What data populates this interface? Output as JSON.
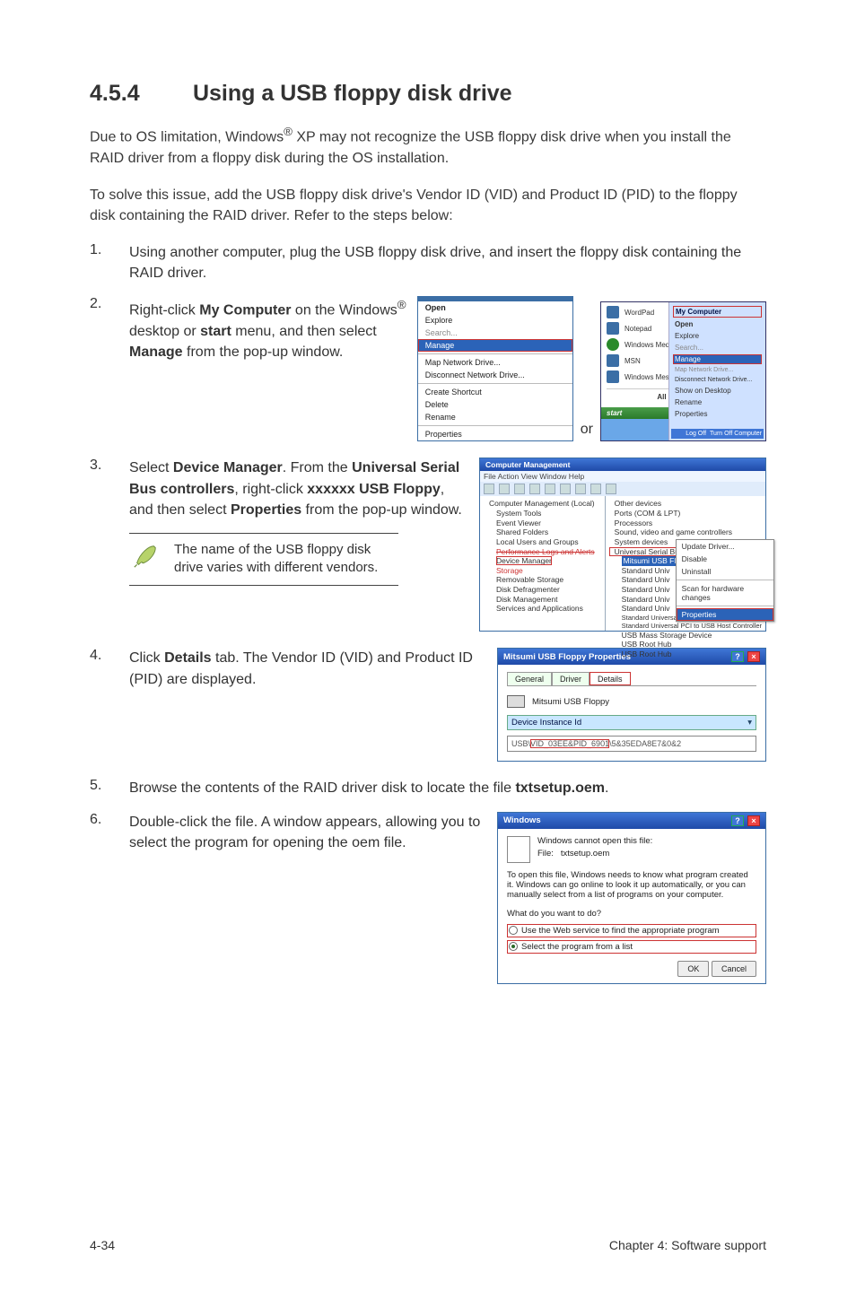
{
  "heading": {
    "num": "4.5.4",
    "title": "Using a USB floppy disk drive"
  },
  "p1a": "Due to OS limitation, Windows",
  "p1_reg": "®",
  "p1b": " XP may not recognize the USB floppy disk drive when you install the RAID driver from a floppy disk during the OS installation.",
  "p2": "To solve this issue, add the USB floppy disk drive's Vendor ID (VID) and Product ID (PID) to the floppy disk containing the RAID driver. Refer to the steps below:",
  "step1": "Using another computer, plug the USB floppy disk drive, and insert the floppy disk containing the RAID driver.",
  "step2": {
    "a": "Right-click ",
    "b_my_computer": "My Computer",
    "c": " on the Windows",
    "reg": "®",
    "d": " desktop or ",
    "e_start": "start",
    "f": " menu, and then select ",
    "g_manage": "Manage",
    "h": " from the pop-up window."
  },
  "or": "or",
  "ctx_menu1": {
    "open": "Open",
    "explore": "Explore",
    "search": "Search...",
    "manage": "Manage",
    "map": "Map Network Drive...",
    "disc": "Disconnect Network Drive...",
    "shortcut": "Create Shortcut",
    "delete": "Delete",
    "rename": "Rename",
    "properties": "Properties"
  },
  "startmenu": {
    "wordpad": "WordPad",
    "notepad": "Notepad",
    "wmp": "Windows Media Player",
    "msn": "MSN",
    "messenger": "Windows Messenger",
    "allprograms": "All Programs",
    "start": "start",
    "logoff": "Log Off",
    "turnoff": "Turn Off Computer"
  },
  "startright": {
    "mycomputer": "My Computer",
    "open": "Open",
    "explore": "Explore",
    "search": "Search...",
    "manage": "Manage",
    "map": "Map Network Drive...",
    "disc": "Disconnect Network Drive...",
    "showdesk": "Show on Desktop",
    "rename": "Rename",
    "properties": "Properties"
  },
  "step3": {
    "a": "Select ",
    "b": "Device Manager",
    "c": ". From the ",
    "d": "Universal Serial Bus controllers",
    "e": ", right-click ",
    "f": "xxxxxx USB Floppy",
    "g": ", and then select ",
    "h": "Properties",
    "i": " from the pop-up window."
  },
  "note": "The name of the USB floppy disk drive varies with different vendors.",
  "mgmt": {
    "title": "Computer Management",
    "menubar": "File   Action   View   Window   Help",
    "leftTree": [
      "Computer Management (Local)",
      "System Tools",
      "Event Viewer",
      "Shared Folders",
      "Local Users and Groups",
      "Performance Logs and Alerts",
      "Device Manager",
      "Storage",
      "Removable Storage",
      "Disk Defragmenter",
      "Disk Management",
      "Services and Applications"
    ],
    "rightTree": [
      "Other devices",
      "Ports (COM & LPT)",
      "Processors",
      "Sound, video and game controllers",
      "System devices",
      "Universal Serial Bus controllers",
      "Mitsumi USB Floppy",
      "Standard Univ",
      "Standard Univ",
      "Standard Univ",
      "Standard Univ",
      "Standard Univ",
      "Standard Universal PCI to USB Host Controller",
      "Standard Universal PCI to USB Host Controller",
      "USB Mass Storage Device",
      "USB Root Hub",
      "USB Root Hub"
    ],
    "popup": {
      "update": "Update Driver...",
      "disable": "Disable",
      "uninstall": "Uninstall",
      "scan": "Scan for hardware changes",
      "properties": "Properties"
    }
  },
  "step4": {
    "a": "Click ",
    "b": "Details",
    "c": " tab. The Vendor ID (VID) and Product ID (PID) are displayed."
  },
  "props": {
    "title": "Mitsumi USB Floppy Properties",
    "tabs": {
      "general": "General",
      "driver": "Driver",
      "details": "Details"
    },
    "devname": "Mitsumi USB Floppy",
    "label": "Device Instance Id",
    "value_pre": "USB\\",
    "value_hl": "VID_03EE&PID_6901",
    "value_post": "\\5&35EDA8E7&0&2"
  },
  "step5": {
    "a": "Browse the contents of the RAID driver disk to locate the file ",
    "b": "txtsetup.oem",
    "c": "."
  },
  "step6": "Double-click the file. A window appears, allowing you to select the program for opening the oem file.",
  "windlg": {
    "title": "Windows",
    "msg": "Windows cannot open this file:",
    "file_label": "File:",
    "file_name": "txtsetup.oem",
    "desc": "To open this file, Windows needs to know what program created it.  Windows can go online to look it up automatically, or you can manually select from a list of programs on your computer.",
    "q": "What do you want to do?",
    "opt1": "Use the Web service to find the appropriate program",
    "opt2": "Select the program from a list",
    "ok": "OK",
    "cancel": "Cancel"
  },
  "footer": {
    "left": "4-34",
    "right": "Chapter 4: Software support"
  }
}
